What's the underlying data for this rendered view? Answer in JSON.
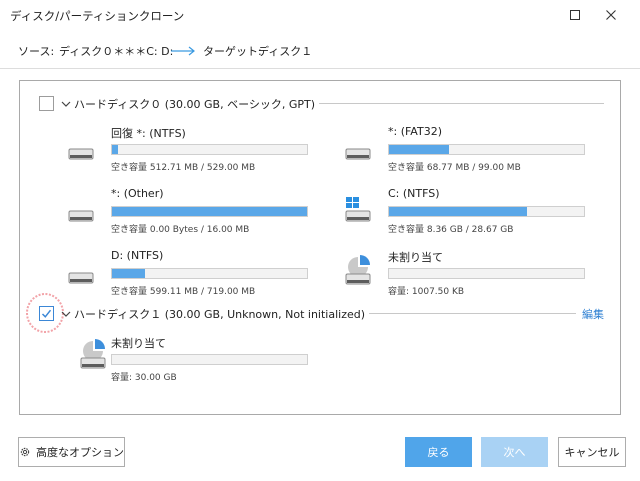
{
  "window": {
    "title": "ディスク/パーティションクローン"
  },
  "route": {
    "source_label": "ソース:",
    "source_value": "ディスク０＊＊＊C: D:",
    "target_label": "ターゲット:",
    "target_value": "ディスク１"
  },
  "disks": [
    {
      "title": "ハードディスク０ (30.00 GB, ベーシック, GPT)",
      "checked": false,
      "partitions": [
        {
          "name": "回復 *:  (NTFS)",
          "capacity": "空き容量 512.71 MB / 529.00 MB",
          "used_fraction": 0.03,
          "icon": "drive-icon"
        },
        {
          "name": "*:  (FAT32)",
          "capacity": "空き容量 68.77 MB / 99.00 MB",
          "used_fraction": 0.31,
          "icon": "drive-icon"
        },
        {
          "name": "*:  (Other)",
          "capacity": "空き容量 0.00 Bytes / 16.00 MB",
          "used_fraction": 1.0,
          "icon": "drive-icon"
        },
        {
          "name": "C:  (NTFS)",
          "capacity": "空き容量 8.36 GB / 28.67 GB",
          "used_fraction": 0.71,
          "icon": "windows-drive-icon"
        },
        {
          "name": "D:  (NTFS)",
          "capacity": "空き容量 599.11 MB / 719.00 MB",
          "used_fraction": 0.17,
          "icon": "drive-icon"
        },
        {
          "name": "未割り当て",
          "capacity": "容量: 1007.50 KB",
          "used_fraction": 0.0,
          "icon": "unallocated-drive-icon"
        }
      ]
    },
    {
      "title": "ハードディスク１ (30.00 GB, Unknown, Not initialized)",
      "checked": true,
      "edit_label": "編集",
      "partitions": [
        {
          "name": "未割り当て",
          "capacity": "容量: 30.00 GB",
          "used_fraction": 0.0,
          "icon": "unallocated-drive-icon"
        }
      ]
    }
  ],
  "footer": {
    "advanced_label": "高度なオプション",
    "back_label": "戻る",
    "next_label": "次へ",
    "cancel_label": "キャンセル"
  },
  "colors": {
    "accent": "#50a5ea",
    "bar_fill": "#5aa7e8",
    "link": "#2d7fd2",
    "highlight_circle": "#f2a3a8"
  }
}
